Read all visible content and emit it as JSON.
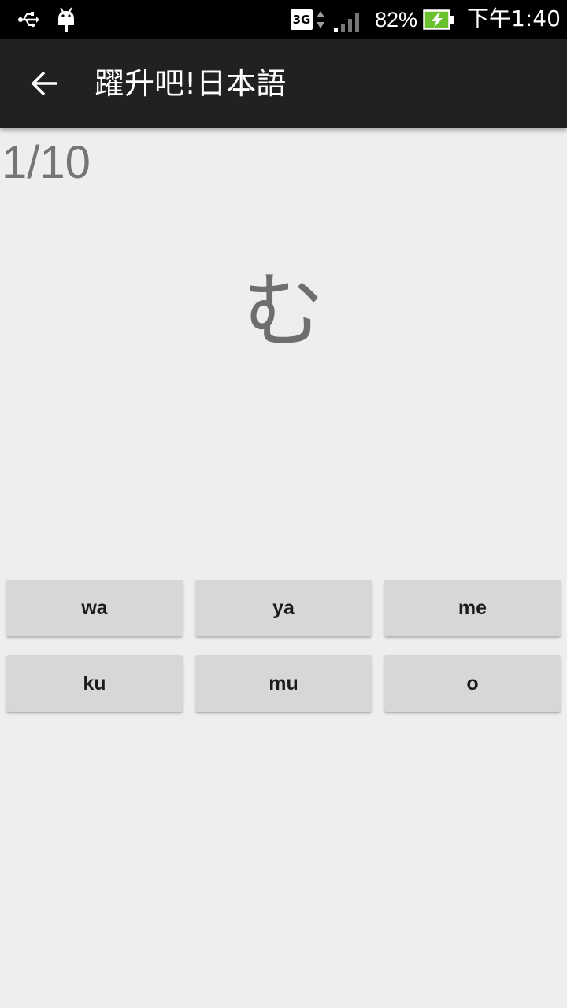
{
  "status_bar": {
    "network_type": "3G",
    "battery_percent": "82%",
    "time": "下午1:40",
    "icons": [
      "usb-icon",
      "android-debug-icon",
      "network-arrows-icon",
      "signal-icon",
      "battery-charging-icon"
    ]
  },
  "app_bar": {
    "back_icon": "arrow-back-icon",
    "title": "躍升吧!日本語"
  },
  "quiz": {
    "progress": "1/10",
    "character": "む",
    "choices": [
      "wa",
      "ya",
      "me",
      "ku",
      "mu",
      "o"
    ]
  },
  "colors": {
    "status_bar_bg": "#000000",
    "app_bar_bg": "#212121",
    "page_bg": "#eeeeee",
    "button_bg": "#d6d7d7",
    "battery_green": "#6ac12d"
  }
}
